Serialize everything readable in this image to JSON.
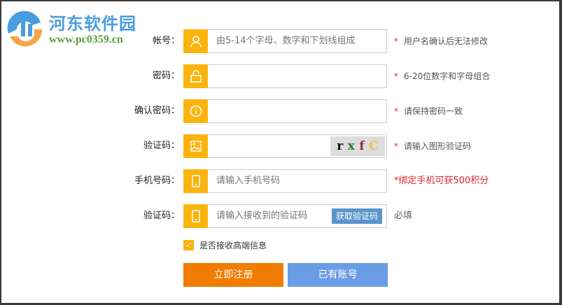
{
  "logo": {
    "title": "河东软件园",
    "url": "www.pc0359.cn"
  },
  "rows": [
    {
      "label": "帐号：",
      "placeholder": "由5-14个字母、数字和下划线组成",
      "hint_star": "*",
      "hint": "用户名确认后无法修改"
    },
    {
      "label": "密码：",
      "placeholder": "",
      "hint_star": "*",
      "hint": "6-20位数字和字母组合"
    },
    {
      "label": "确认密码：",
      "placeholder": "",
      "hint_star": "*",
      "hint": "请保持密码一致"
    },
    {
      "label": "验证码：",
      "placeholder": "",
      "hint_star": "*",
      "hint": "请输入图形验证码",
      "captcha": [
        "r",
        "x",
        "f",
        "C"
      ]
    },
    {
      "label": "手机号码：",
      "placeholder": "请输入手机号码",
      "hint": "*绑定手机可获500积分"
    },
    {
      "label": "验证码：",
      "placeholder": "请输入接收到的验证码",
      "button": "获取验证码",
      "hint": "必填"
    }
  ],
  "checkbox": {
    "label": "是否接收高端信息",
    "checked": true,
    "mark": "✓"
  },
  "buttons": {
    "register": "立即注册",
    "have_account": "已有账号"
  },
  "colors": {
    "accent": "#fbb40e",
    "register": "#f07d00",
    "have_account": "#6b9de6",
    "error": "#e0262d"
  }
}
